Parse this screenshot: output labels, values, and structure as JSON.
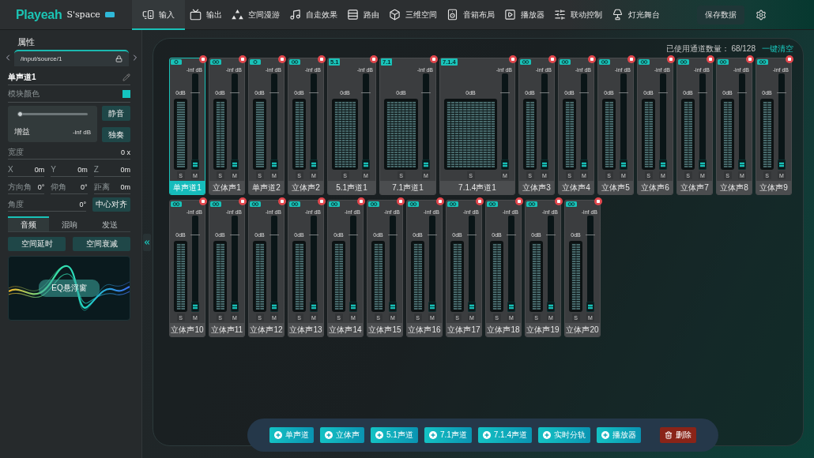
{
  "header": {
    "logo": "Playeah",
    "product": "S'space"
  },
  "nav": [
    {
      "label": "输入",
      "selected": true
    },
    {
      "label": "输出",
      "selected": false
    },
    {
      "label": "空间漫游",
      "selected": false
    },
    {
      "label": "自走效果",
      "selected": false
    },
    {
      "label": "路由",
      "selected": false
    },
    {
      "label": "三维空间",
      "selected": false
    },
    {
      "label": "音箱布局",
      "selected": false
    },
    {
      "label": "播放器",
      "selected": false
    },
    {
      "label": "联动控制",
      "selected": false
    },
    {
      "label": "灯光舞台",
      "selected": false
    }
  ],
  "save_button": "保存数据",
  "properties": {
    "title": "属性",
    "path": "/input/source/1",
    "name": "单声道1",
    "color_label": "模块颜色",
    "color": "#14c4c0",
    "gain": {
      "label": "增益",
      "value": "-inf dB",
      "level": 0
    },
    "mute_button": "静音",
    "solo_button": "独奏",
    "width": {
      "label": "宽度",
      "value": "0 x"
    },
    "position": [
      {
        "label": "X",
        "value": "0m"
      },
      {
        "label": "Y",
        "value": "0m"
      },
      {
        "label": "Z",
        "value": "0m"
      }
    ],
    "orientation": [
      {
        "label": "方向角",
        "value": "0°"
      },
      {
        "label": "仰角",
        "value": "0°"
      },
      {
        "label": "距离",
        "value": "0m"
      }
    ],
    "angle": {
      "label": "角度",
      "value": "0°"
    },
    "center_button": "中心对齐",
    "tabs": [
      {
        "label": "音频",
        "selected": true
      },
      {
        "label": "混响",
        "selected": false
      },
      {
        "label": "发送",
        "selected": false
      }
    ],
    "actions": [
      "空间延时",
      "空间衰减"
    ],
    "eq_button": "EQ悬浮窗"
  },
  "mixer": {
    "usage": "已使用通道数量： 68/128",
    "clear_link": "一键清空",
    "rows": [
      {
        "channels": [
          {
            "name": "单声道1",
            "kind": "mono",
            "selected": true,
            "peak": "-inf dB",
            "scale": "0dB",
            "level": 0,
            "solo": "S",
            "mute": "M"
          },
          {
            "name": "立体声1",
            "kind": "stereo",
            "selected": false,
            "peak": "-inf dB",
            "scale": "0dB",
            "level": 0,
            "solo": "S",
            "mute": "M"
          },
          {
            "name": "单声道2",
            "kind": "mono",
            "selected": false,
            "peak": "-inf dB",
            "scale": "0dB",
            "level": 0,
            "solo": "S",
            "mute": "M"
          },
          {
            "name": "立体声2",
            "kind": "stereo",
            "selected": false,
            "peak": "-inf dB",
            "scale": "0dB",
            "level": 0,
            "solo": "S",
            "mute": "M"
          },
          {
            "name": "5.1声道1",
            "kind": "surround51",
            "tag": "5.1",
            "selected": false,
            "peak": "-inf dB",
            "scale": "0dB",
            "level": 0,
            "solo": "S",
            "mute": "M"
          },
          {
            "name": "7.1声道1",
            "kind": "surround71",
            "tag": "7.1",
            "selected": false,
            "peak": "-inf dB",
            "scale": "0dB",
            "level": 0,
            "solo": "S",
            "mute": "M"
          },
          {
            "name": "7.1.4声道1",
            "kind": "surround714",
            "tag": "7.1.4",
            "selected": false,
            "peak": "-inf dB",
            "scale": "0dB",
            "level": 0,
            "solo": "S",
            "mute": "M"
          },
          {
            "name": "立体声3",
            "kind": "stereo",
            "selected": false,
            "peak": "-inf dB",
            "scale": "0dB",
            "level": 0,
            "solo": "S",
            "mute": "M"
          },
          {
            "name": "立体声4",
            "kind": "stereo",
            "selected": false,
            "peak": "-inf dB",
            "scale": "0dB",
            "level": 0,
            "solo": "S",
            "mute": "M"
          },
          {
            "name": "立体声5",
            "kind": "stereo",
            "selected": false,
            "peak": "-inf dB",
            "scale": "0dB",
            "level": 0,
            "solo": "S",
            "mute": "M"
          },
          {
            "name": "立体声6",
            "kind": "stereo",
            "selected": false,
            "peak": "-inf dB",
            "scale": "0dB",
            "level": 0,
            "solo": "S",
            "mute": "M"
          },
          {
            "name": "立体声7",
            "kind": "stereo",
            "selected": false,
            "peak": "-inf dB",
            "scale": "0dB",
            "level": 0,
            "solo": "S",
            "mute": "M"
          },
          {
            "name": "立体声8",
            "kind": "stereo",
            "selected": false,
            "peak": "-inf dB",
            "scale": "0dB",
            "level": 0,
            "solo": "S",
            "mute": "M"
          },
          {
            "name": "立体声9",
            "kind": "stereo",
            "selected": false,
            "peak": "-inf dB",
            "scale": "0dB",
            "level": 0,
            "solo": "S",
            "mute": "M"
          }
        ]
      },
      {
        "channels": [
          {
            "name": "立体声10",
            "kind": "stereo",
            "selected": false,
            "peak": "-inf dB",
            "scale": "0dB",
            "level": 0,
            "solo": "S",
            "mute": "M"
          },
          {
            "name": "立体声11",
            "kind": "stereo",
            "selected": false,
            "peak": "-inf dB",
            "scale": "0dB",
            "level": 0,
            "solo": "S",
            "mute": "M"
          },
          {
            "name": "立体声12",
            "kind": "stereo",
            "selected": false,
            "peak": "-inf dB",
            "scale": "0dB",
            "level": 0,
            "solo": "S",
            "mute": "M"
          },
          {
            "name": "立体声13",
            "kind": "stereo",
            "selected": false,
            "peak": "-inf dB",
            "scale": "0dB",
            "level": 0,
            "solo": "S",
            "mute": "M"
          },
          {
            "name": "立体声14",
            "kind": "stereo",
            "selected": false,
            "peak": "-inf dB",
            "scale": "0dB",
            "level": 0,
            "solo": "S",
            "mute": "M"
          },
          {
            "name": "立体声15",
            "kind": "stereo",
            "selected": false,
            "peak": "-inf dB",
            "scale": "0dB",
            "level": 0,
            "solo": "S",
            "mute": "M"
          },
          {
            "name": "立体声16",
            "kind": "stereo",
            "selected": false,
            "peak": "-inf dB",
            "scale": "0dB",
            "level": 0,
            "solo": "S",
            "mute": "M"
          },
          {
            "name": "立体声17",
            "kind": "stereo",
            "selected": false,
            "peak": "-inf dB",
            "scale": "0dB",
            "level": 0,
            "solo": "S",
            "mute": "M"
          },
          {
            "name": "立体声18",
            "kind": "stereo",
            "selected": false,
            "peak": "-inf dB",
            "scale": "0dB",
            "level": 0,
            "solo": "S",
            "mute": "M"
          },
          {
            "name": "立体声19",
            "kind": "stereo",
            "selected": false,
            "peak": "-inf dB",
            "scale": "0dB",
            "level": 0,
            "solo": "S",
            "mute": "M"
          },
          {
            "name": "立体声20",
            "kind": "stereo",
            "selected": false,
            "peak": "-inf dB",
            "scale": "0dB",
            "level": 0,
            "solo": "S",
            "mute": "M"
          }
        ]
      }
    ]
  },
  "toolbar": [
    {
      "label": "单声道",
      "kind": "add"
    },
    {
      "label": "立体声",
      "kind": "add"
    },
    {
      "label": "5.1声道",
      "kind": "add"
    },
    {
      "label": "7.1声道",
      "kind": "add"
    },
    {
      "label": "7.1.4声道",
      "kind": "add"
    },
    {
      "label": "实时分轨",
      "kind": "add"
    },
    {
      "label": "播放器",
      "kind": "add"
    },
    {
      "label": "删除",
      "kind": "delete"
    }
  ]
}
